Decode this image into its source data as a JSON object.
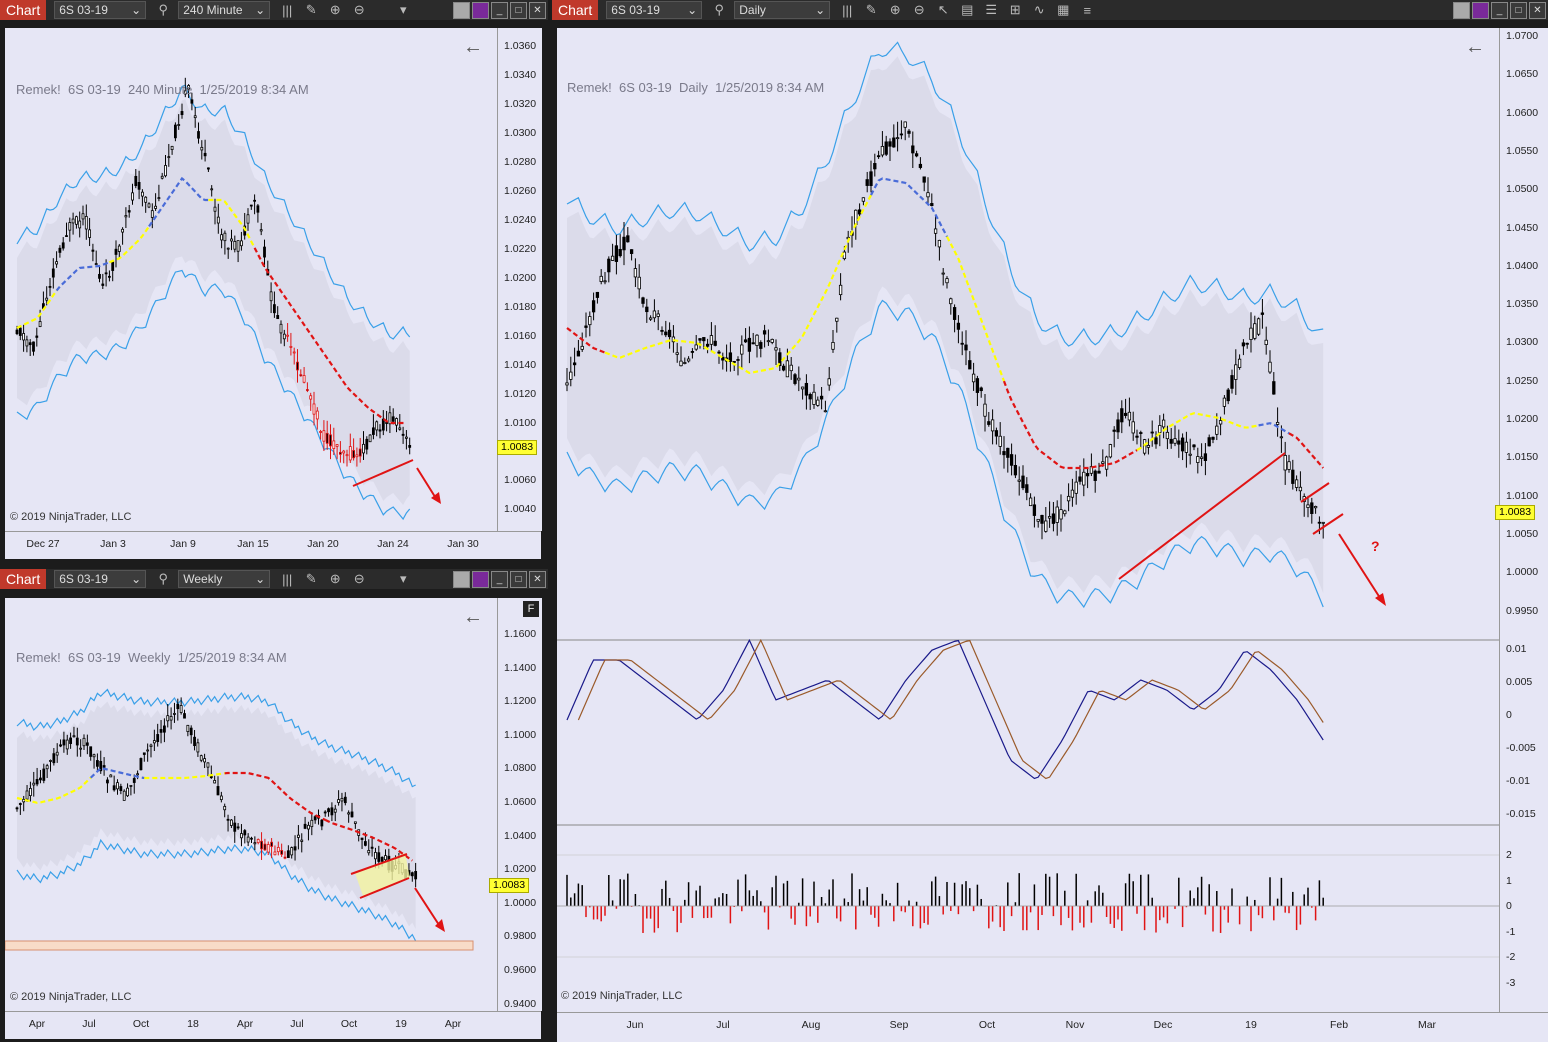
{
  "colors": {
    "panel_bg": "#e6e6f5",
    "band_fill": "#d5d5e6",
    "band_line": "#3aa0e8",
    "red": "#e01414",
    "yellow": "#ffff00",
    "blue": "#4a6cd8",
    "osc_blue": "#1a1a8a",
    "osc_brown": "#9a5a2a"
  },
  "app_label": "Chart",
  "windows": [
    {
      "id": "w240",
      "instrument": "6S 03-19",
      "period": "240 Minute",
      "title": "Remek!  6S 03-19  240 Minute  1/25/2019 8:34 AM",
      "copyright": "© 2019 NinjaTrader, LLC",
      "price_tag": "1.0083",
      "y_ticks": [
        "1.0360",
        "1.0340",
        "1.0320",
        "1.0300",
        "1.0280",
        "1.0260",
        "1.0240",
        "1.0220",
        "1.0200",
        "1.0180",
        "1.0160",
        "1.0140",
        "1.0120",
        "1.0100",
        "1.0060",
        "1.0040"
      ],
      "x_ticks": [
        "Dec 27",
        "Jan 3",
        "Jan 9",
        "Jan 15",
        "Jan 20",
        "Jan 24",
        "Jan 30"
      ]
    },
    {
      "id": "wweekly",
      "instrument": "6S 03-19",
      "period": "Weekly",
      "title": "Remek!  6S 03-19  Weekly  1/25/2019 8:34 AM",
      "copyright": "© 2019 NinjaTrader, LLC",
      "price_tag": "1.0083",
      "f_label": "F",
      "y_ticks": [
        "1.1600",
        "1.1400",
        "1.1200",
        "1.1000",
        "1.0800",
        "1.0600",
        "1.0400",
        "1.0200",
        "1.0000",
        "0.9800",
        "0.9600",
        "0.9400"
      ],
      "x_ticks": [
        "Apr",
        "Jul",
        "Oct",
        "18",
        "Apr",
        "Jul",
        "Oct",
        "19",
        "Apr"
      ]
    },
    {
      "id": "wdaily",
      "instrument": "6S 03-19",
      "period": "Daily",
      "title": "Remek!  6S 03-19  Daily  1/25/2019 8:34 AM",
      "copyright": "© 2019 NinjaTrader, LLC",
      "price_tag": "1.0083",
      "question": "?",
      "y_ticks": [
        "1.0700",
        "1.0650",
        "1.0600",
        "1.0550",
        "1.0500",
        "1.0450",
        "1.0400",
        "1.0350",
        "1.0300",
        "1.0250",
        "1.0200",
        "1.0150",
        "1.0100",
        "1.0050",
        "1.0000",
        "0.9950"
      ],
      "osc_ticks": [
        "0.01",
        "0.005",
        "0",
        "-0.005",
        "-0.01",
        "-0.015"
      ],
      "hist_ticks": [
        "2",
        "1",
        "0",
        "-1",
        "-2",
        "-3"
      ],
      "x_ticks": [
        "Jun",
        "Jul",
        "Aug",
        "Sep",
        "Oct",
        "Nov",
        "Dec",
        "19",
        "Feb",
        "Mar"
      ]
    }
  ]
}
